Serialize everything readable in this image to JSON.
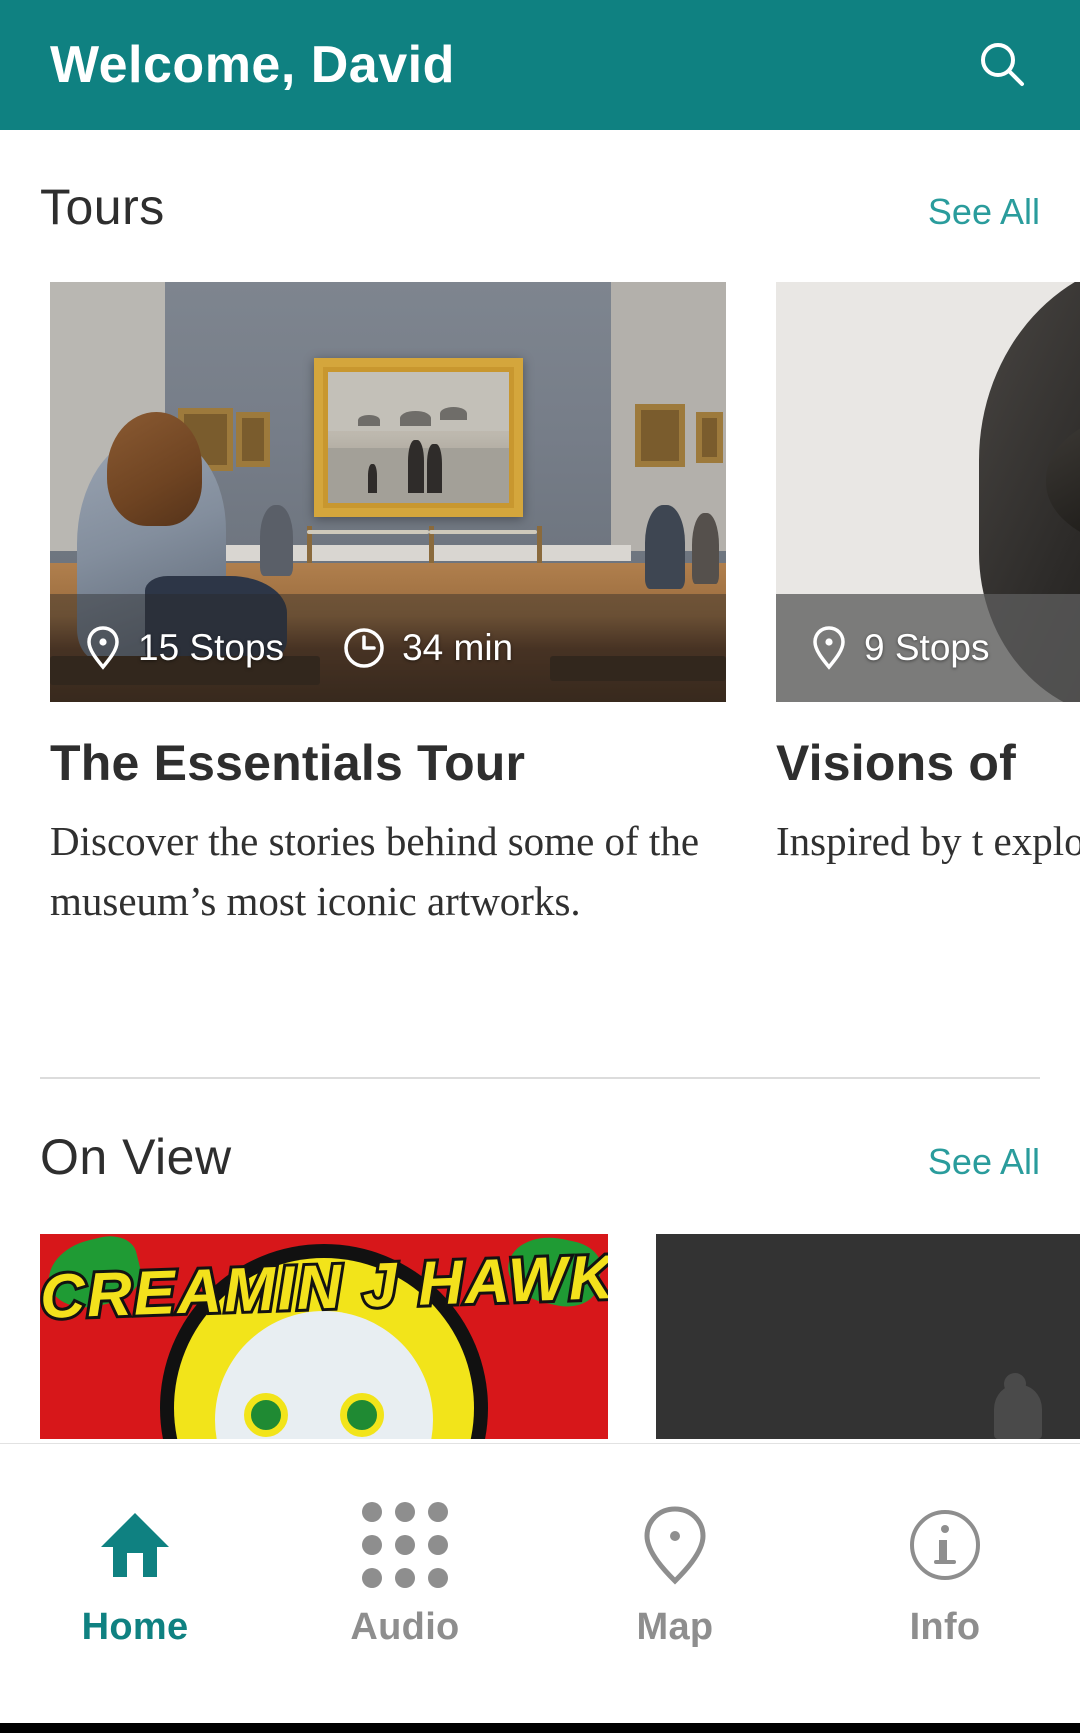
{
  "header": {
    "title": "Welcome, David",
    "search_icon": "search-icon",
    "background_color": "#0f8181",
    "text_color": "#ffffff"
  },
  "accent_color": "#2a9c9c",
  "sections": [
    {
      "id": "tours",
      "title": "Tours",
      "see_all_label": "See All"
    },
    {
      "id": "on-view",
      "title": "On View",
      "see_all_label": "See All"
    }
  ],
  "tours": [
    {
      "title": "The Essentials Tour",
      "description": "Discover the stories behind some of the museum’s most iconic artworks.",
      "stops": "15 Stops",
      "duration": "34 min",
      "stops_icon": "map-pin-icon",
      "duration_icon": "clock-icon",
      "image_alt": "gallery-visitor-viewing-painting"
    },
    {
      "title": "Visions of",
      "description": "Inspired by t explore Ame America ther",
      "stops": "9 Stops",
      "stops_icon": "map-pin-icon",
      "image_alt": "bronze-sculpture"
    }
  ],
  "on_view": [
    {
      "image_alt": "screamin-j-hawkins-poster",
      "poster_text": "CREAMIN J HAWKIN"
    },
    {
      "image_alt": "dark-gallery-artwork"
    }
  ],
  "tabbar": {
    "items": [
      {
        "label": "Home",
        "icon": "home-icon",
        "active": true
      },
      {
        "label": "Audio",
        "icon": "grid-dots-icon",
        "active": false
      },
      {
        "label": "Map",
        "icon": "map-pin-icon",
        "active": false
      },
      {
        "label": "Info",
        "icon": "info-circle-icon",
        "active": false
      }
    ]
  }
}
